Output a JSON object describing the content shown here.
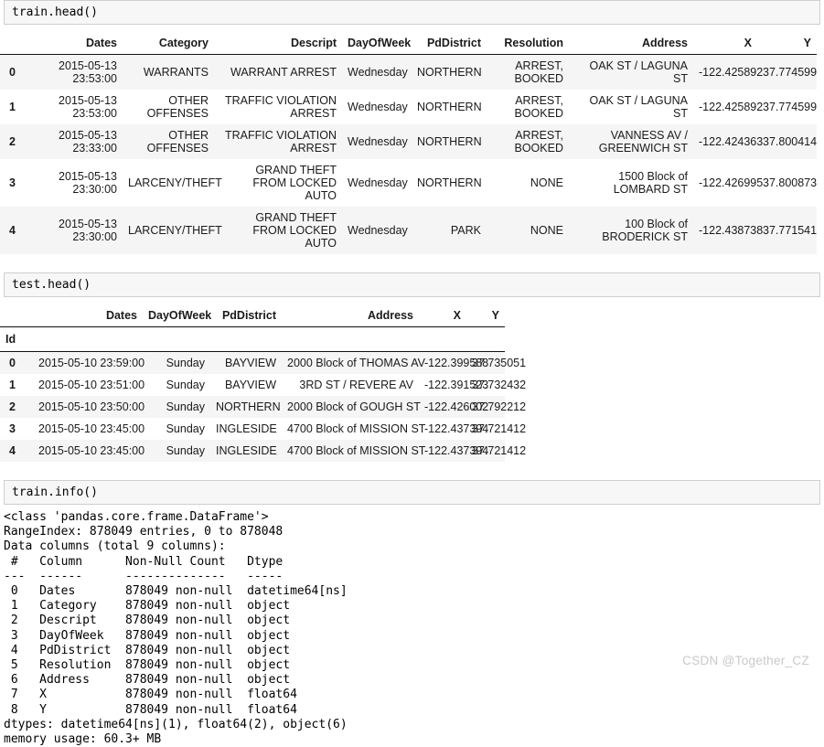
{
  "cells": [
    {
      "code": "train.head()"
    },
    {
      "code": "test.head()"
    },
    {
      "code": "train.info()"
    }
  ],
  "train_table": {
    "index_name": "",
    "columns": [
      "Dates",
      "Category",
      "Descript",
      "DayOfWeek",
      "PdDistrict",
      "Resolution",
      "Address",
      "X",
      "Y"
    ],
    "index": [
      "0",
      "1",
      "2",
      "3",
      "4"
    ],
    "rows": [
      [
        "2015-05-13 23:53:00",
        "WARRANTS",
        "WARRANT ARREST",
        "Wednesday",
        "NORTHERN",
        "ARREST, BOOKED",
        "OAK ST / LAGUNA ST",
        "-122.425892",
        "37.774599"
      ],
      [
        "2015-05-13 23:53:00",
        "OTHER OFFENSES",
        "TRAFFIC VIOLATION ARREST",
        "Wednesday",
        "NORTHERN",
        "ARREST, BOOKED",
        "OAK ST / LAGUNA ST",
        "-122.425892",
        "37.774599"
      ],
      [
        "2015-05-13 23:33:00",
        "OTHER OFFENSES",
        "TRAFFIC VIOLATION ARREST",
        "Wednesday",
        "NORTHERN",
        "ARREST, BOOKED",
        "VANNESS AV / GREENWICH ST",
        "-122.424363",
        "37.800414"
      ],
      [
        "2015-05-13 23:30:00",
        "LARCENY/THEFT",
        "GRAND THEFT FROM LOCKED AUTO",
        "Wednesday",
        "NORTHERN",
        "NONE",
        "1500 Block of LOMBARD ST",
        "-122.426995",
        "37.800873"
      ],
      [
        "2015-05-13 23:30:00",
        "LARCENY/THEFT",
        "GRAND THEFT FROM LOCKED AUTO",
        "Wednesday",
        "PARK",
        "NONE",
        "100 Block of BRODERICK ST",
        "-122.438738",
        "37.771541"
      ]
    ]
  },
  "test_table": {
    "index_name": "Id",
    "columns": [
      "Dates",
      "DayOfWeek",
      "PdDistrict",
      "Address",
      "X",
      "Y"
    ],
    "index": [
      "0",
      "1",
      "2",
      "3",
      "4"
    ],
    "rows": [
      [
        "2015-05-10 23:59:00",
        "Sunday",
        "BAYVIEW",
        "2000 Block of THOMAS AV",
        "-122.399588",
        "37.735051"
      ],
      [
        "2015-05-10 23:51:00",
        "Sunday",
        "BAYVIEW",
        "3RD ST / REVERE AV",
        "-122.391523",
        "37.732432"
      ],
      [
        "2015-05-10 23:50:00",
        "Sunday",
        "NORTHERN",
        "2000 Block of GOUGH ST",
        "-122.426002",
        "37.792212"
      ],
      [
        "2015-05-10 23:45:00",
        "Sunday",
        "INGLESIDE",
        "4700 Block of MISSION ST",
        "-122.437394",
        "37.721412"
      ],
      [
        "2015-05-10 23:45:00",
        "Sunday",
        "INGLESIDE",
        "4700 Block of MISSION ST",
        "-122.437394",
        "37.721412"
      ]
    ]
  },
  "info_output": "<class 'pandas.core.frame.DataFrame'>\nRangeIndex: 878049 entries, 0 to 878048\nData columns (total 9 columns):\n #   Column      Non-Null Count   Dtype         \n---  ------      --------------   -----         \n 0   Dates       878049 non-null  datetime64[ns]\n 1   Category    878049 non-null  object        \n 2   Descript    878049 non-null  object        \n 3   DayOfWeek   878049 non-null  object        \n 4   PdDistrict  878049 non-null  object        \n 5   Resolution  878049 non-null  object        \n 6   Address     878049 non-null  object        \n 7   X           878049 non-null  float64       \n 8   Y           878049 non-null  float64       \ndtypes: datetime64[ns](1), float64(2), object(6)\nmemory usage: 60.3+ MB",
  "watermark": "CSDN @Together_CZ",
  "colors": {
    "cell_background": "#f7f7f7",
    "cell_border": "#cfcfcf",
    "row_stripe": "#f5f5f5",
    "text": "#000000",
    "watermark": "#c9c9c9"
  }
}
